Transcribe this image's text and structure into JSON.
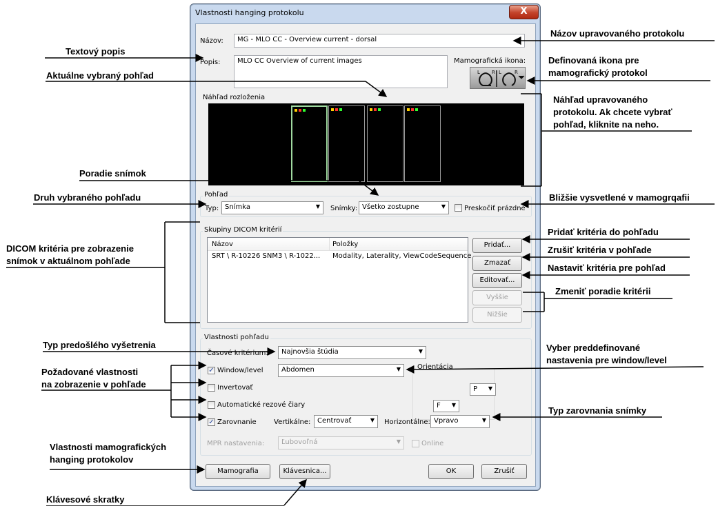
{
  "dialog": {
    "title": "Vlastnosti hanging protokolu",
    "close_label": "X",
    "name_label": "Názov:",
    "name_value": "MG - MLO CC - Overview current - dorsal",
    "desc_label": "Popis:",
    "desc_value": "MLO CC Overview of current images",
    "mammo_icon_label": "Mamografická ikona:",
    "mammo_icon_letters": [
      "L",
      "R",
      "L",
      "R"
    ],
    "layout_preview_title": "Náhľad rozloženia",
    "view_group_title": "Pohľad",
    "type_label": "Typ:",
    "type_value": "Snímka",
    "images_label": "Snímky:",
    "images_value": "Všetko zostupne",
    "skip_empty_label": "Preskočiť prázdne",
    "dicom_group_title": "Skupiny DICOM kritérií",
    "table_headers": [
      "Názov",
      "Položky"
    ],
    "table_rows": [
      {
        "name": "SRT \\ R-10226 SNM3 \\ R-1022...",
        "items": "Modality, Laterality, ViewCodeSequence"
      }
    ],
    "btn_add": "Pridať...",
    "btn_delete": "Zmazať",
    "btn_edit": "Editovať...",
    "btn_up": "Vyššie",
    "btn_down": "Nižšie",
    "props_group_title": "Vlastnosti pohľadu",
    "time_criterion_label": "Časové kritérium:",
    "time_criterion_value": "Najnovšia štúdia",
    "window_level_label": "Window/level",
    "window_level_value": "Abdomen",
    "orientation_label": "Orientácia",
    "orientation_h_value": "P",
    "orientation_v_value": "F",
    "invert_label": "Invertovať",
    "auto_lines_label": "Automatické rezové čiary",
    "align_label": "Zarovnanie",
    "vertical_label": "Vertikálne:",
    "vertical_value": "Centrovať",
    "horizontal_label": "Horizontálne:",
    "horizontal_value": "Vpravo",
    "mpr_label": "MPR nastavenia:",
    "mpr_value": "Ľubovoľná",
    "online_label": "Online",
    "btn_mammo": "Mamografia",
    "btn_keyboard": "Klávesnica...",
    "btn_ok": "OK",
    "btn_cancel": "Zrušiť",
    "checked": {
      "window_level": true,
      "invert": false,
      "auto_lines": false,
      "align": true,
      "skip_empty": false,
      "online": false
    }
  },
  "annotations": {
    "left": {
      "text_desc": "Textový popis",
      "selected_view": "Aktuálne vybraný pohľad",
      "image_order": "Poradie snímok",
      "view_type": "Druh vybraného pohľadu",
      "dicom_criteria_1": "DICOM kritéria pre zobrazenie",
      "dicom_criteria_2": "snímok v aktuálnom pohľade",
      "prior_exam": "Typ predošlého vyšetrenia",
      "required_props_1": "Požadované vlastnosti",
      "required_props_2": "na zobrazenie v pohľade",
      "mammo_props_1": "Vlastnosti mamografických",
      "mammo_props_2": "hanging protokolov",
      "shortcuts": "Klávesové skratky"
    },
    "right": {
      "protocol_name": "Názov upravovaného protokolu",
      "icon_1": "Definovaná ikona pre",
      "icon_2": "mamografický protokol",
      "preview_1": "Náhľad upravovaného",
      "preview_2": "protokolu. Ak chcete vybrať",
      "preview_3": "pohľad, kliknite na neho.",
      "mammo_more": "Bližšie vysvetlené v mamogrqafii",
      "add_criteria": "Pridať kritéria do pohľadu",
      "remove_criteria": "Zrušiť kritéria v pohľade",
      "set_criteria": "Nastaviť kritéria pre pohľad",
      "change_order": "Zmeniť poradie kritérii",
      "wl_preset_1": "Vyber preddefinované",
      "wl_preset_2": "nastavenia pre window/level",
      "align_type": "Typ zarovnania snímky"
    }
  }
}
